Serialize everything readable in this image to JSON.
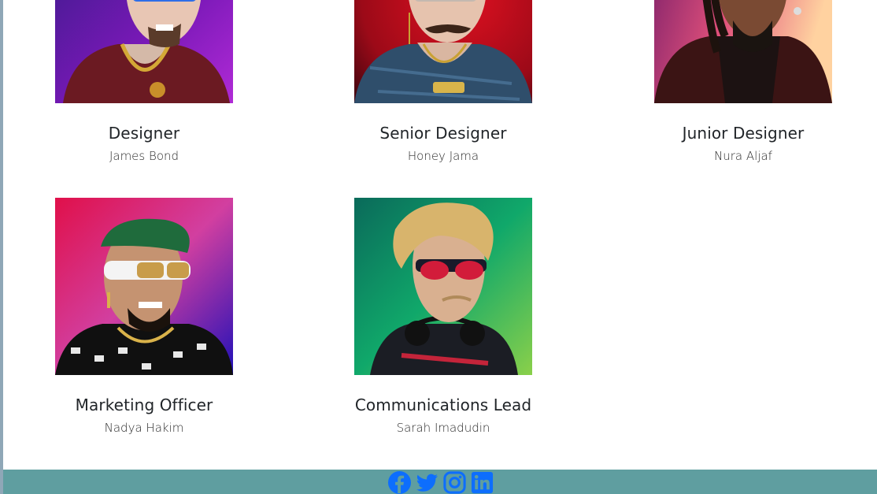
{
  "team": [
    {
      "role": "Designer",
      "name": "James Bond",
      "avatar": "avatar-purple-cap-icon"
    },
    {
      "role": "Senior Designer",
      "name": "Honey Jama",
      "avatar": "avatar-red-moustache-icon"
    },
    {
      "role": "Junior Designer",
      "name": "Nura Aljaf",
      "avatar": "avatar-dreadlocks-icon"
    },
    {
      "role": "Marketing Officer",
      "name": "Nadya Hakim",
      "avatar": "avatar-green-beret-icon"
    },
    {
      "role": "Communications Lead",
      "name": "Sarah Imadudin",
      "avatar": "avatar-blonde-sunglasses-icon"
    }
  ],
  "footer": {
    "background": "#5f9ea0",
    "icon_color": "#0d6efd",
    "social": [
      "facebook-icon",
      "twitter-icon",
      "instagram-icon",
      "linkedin-icon"
    ]
  }
}
